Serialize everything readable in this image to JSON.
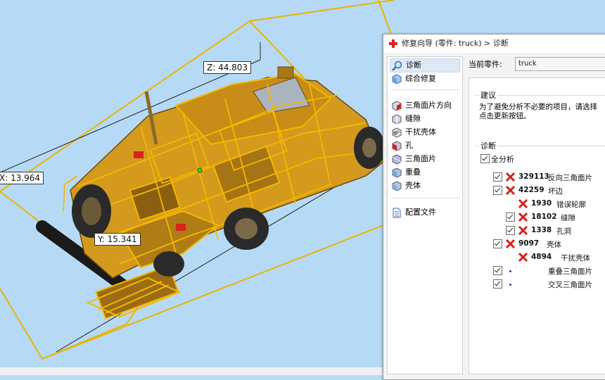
{
  "viewport": {
    "dimension_labels": {
      "z": "Z: 44.803",
      "x": "X: 13.964",
      "y": "Y: 15.341"
    }
  },
  "wizard": {
    "title": "修复向导 (零件: truck) > 诊断",
    "nav": {
      "diagnose": "诊断",
      "repair": "综合修复",
      "triangle_orientation": "三角面片方向",
      "gap": "缝隙",
      "interfering_shell": "干扰壳体",
      "hole": "孔",
      "triangles": "三角面片",
      "overlap": "重叠",
      "shell": "壳体",
      "profile": "配置文件"
    },
    "current_part_label": "当前零件:",
    "current_part_value": "truck",
    "advice": {
      "title": "建议",
      "line1": "为了避免分析不必要的项目，请选择",
      "line2": "点击更新按钮。"
    },
    "diagnosis": {
      "title": "诊断",
      "full_analysis": "全分析",
      "rows": [
        {
          "count": "329113",
          "label": "反向三角面片"
        },
        {
          "count": "42259",
          "label": "坏边"
        },
        {
          "count": "1930",
          "label": "错误轮廓"
        },
        {
          "count": "18102",
          "label": "缝隙"
        },
        {
          "count": "1338",
          "label": "孔洞"
        },
        {
          "count": "9097",
          "label": "壳体"
        },
        {
          "count": "4894",
          "label": "干扰壳体"
        },
        {
          "count": "",
          "label": "重叠三角面片"
        },
        {
          "count": "",
          "label": "交叉三角面片"
        }
      ]
    }
  },
  "colors": {
    "viewport_bg": "#b6daf5",
    "wireframe": "#f5b800",
    "error_red": "#d6241c",
    "dot_blue": "#1a3fb0"
  }
}
